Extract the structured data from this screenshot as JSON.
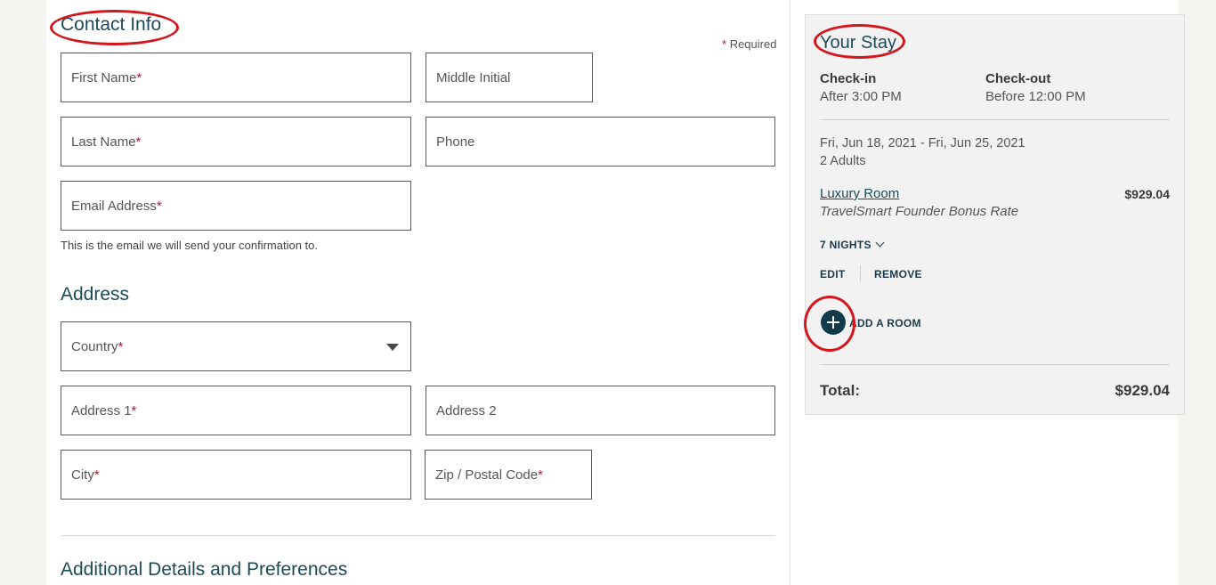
{
  "contact": {
    "title": "Contact Info",
    "required_note": "Required",
    "required_marker": "*",
    "first_name": "First Name",
    "middle_initial": "Middle Initial",
    "last_name": "Last Name",
    "phone": "Phone",
    "email": "Email Address",
    "email_hint": "This is the email we will send your confirmation to."
  },
  "address": {
    "title": "Address",
    "country": "Country",
    "address1": "Address 1",
    "address2": "Address 2",
    "city": "City",
    "zip": "Zip / Postal Code"
  },
  "additional": {
    "title": "Additional Details and Preferences"
  },
  "stay": {
    "title": "Your Stay",
    "checkin_label": "Check-in",
    "checkin_value": "After 3:00 PM",
    "checkout_label": "Check-out",
    "checkout_value": "Before 12:00 PM",
    "dates": "Fri, Jun 18, 2021 - Fri, Jun 25, 2021",
    "guests": "2 Adults",
    "room_name": "Luxury Room",
    "rate_name": "TravelSmart Founder Bonus Rate",
    "room_price": "$929.04",
    "nights": "7 NIGHTS",
    "edit": "EDIT",
    "remove": "REMOVE",
    "add_room": "ADD A ROOM",
    "total_label": "Total:",
    "total_value": "$929.04"
  },
  "colors": {
    "accent": "#1d4a5a",
    "required": "#a0203c",
    "annotation": "#d4161c",
    "button": "#123a4a"
  }
}
